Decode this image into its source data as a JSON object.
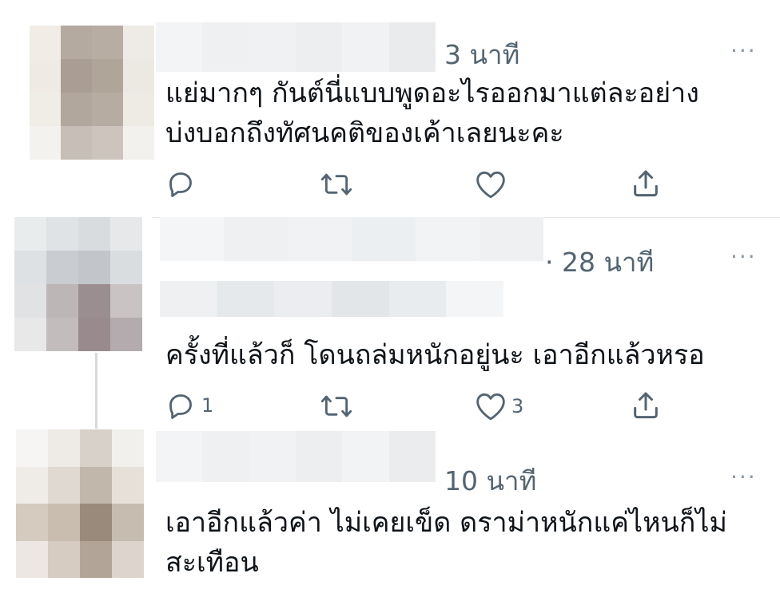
{
  "tweets": [
    {
      "time": "3 นาที",
      "text": "แย่มากๆ กันต์นี่แบบพูดอะไรออกมาแต่ละอย่าง\nบ่งบอกถึงทัศนคติของเค้าเลยนะคะ",
      "reply_count": "",
      "like_count": ""
    },
    {
      "time": "· 28 นาที",
      "text": "ครั้งที่แล้วก็ โดนถล่มหนักอยู่นะ เอาอีกแล้วหรอ",
      "reply_count": "1",
      "like_count": "3"
    },
    {
      "time": "10 นาที",
      "text": "เอาอีกแล้วค่า ไม่เคยเข็ด ดราม่าหนักแค่ไหนก็ไม่\nสะเทือน",
      "reply_count": "",
      "like_count": ""
    }
  ],
  "more_label": "···",
  "icons": {
    "reply": "reply-icon",
    "retweet": "retweet-icon",
    "like": "like-icon",
    "share": "share-icon"
  },
  "colors": {
    "icon": "#536471",
    "text": "#0f1419",
    "meta": "#536471"
  }
}
